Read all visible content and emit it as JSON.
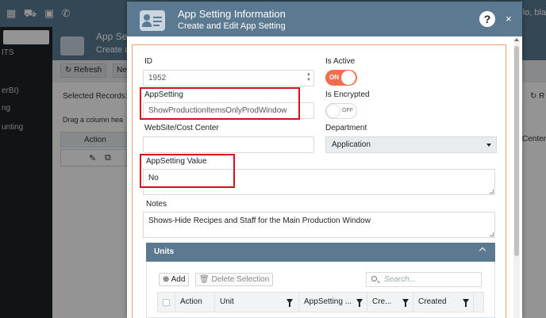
{
  "background": {
    "top_icons": "▦ ⛟ ▣ ✆",
    "greeting": "ello, bla",
    "sidebar_items": [
      "ITS",
      "erBI)",
      "ng",
      "unting"
    ],
    "header_title": "App Se",
    "header_subtitle": "Create a",
    "toolbar": {
      "refresh_label": "↻ Refresh",
      "new_label": "Nev"
    },
    "selected_records": "Selected Records:",
    "drag_hint": "Drag a column hea",
    "grid_action": "Action",
    "row_edit_icon": "✎",
    "row_copy_icon": "⧉",
    "right_refresh": "↻ R",
    "right_column": "Center"
  },
  "modal": {
    "title": "App Setting Information",
    "subtitle": "Create and Edit App Setting",
    "help_label": "?",
    "close_label": "×",
    "form": {
      "id_label": "ID",
      "id_value": "1952",
      "is_active_label": "Is Active",
      "is_active_state": "ON",
      "appsetting_label": "AppSetting",
      "appsetting_value": "ShowProductionItemsOnlyProdWindow",
      "is_encrypted_label": "Is Encrypted",
      "is_encrypted_state": "OFF",
      "website_label": "WebSite/Cost Center",
      "website_value": "",
      "department_label": "Department",
      "department_value": "Application",
      "appsetting_value_label": "AppSetting Value",
      "appsetting_value_value": "No",
      "notes_label": "Notes",
      "notes_value": "Shows-Hide Recipes and Staff for the Main Production Window"
    },
    "units": {
      "title": "Units",
      "add_label": "⊕ Add",
      "delete_label": "🗑 Delete Selection",
      "search_placeholder": "Search...",
      "columns": [
        "Action",
        "Unit",
        "AppSetting ...",
        "Cre...",
        "Created"
      ]
    }
  },
  "colors": {
    "header_bg": "#5b7a91",
    "toggle_on": "#f06e4f",
    "highlight": "#d6101a",
    "frame_border": "#e8a07a"
  }
}
